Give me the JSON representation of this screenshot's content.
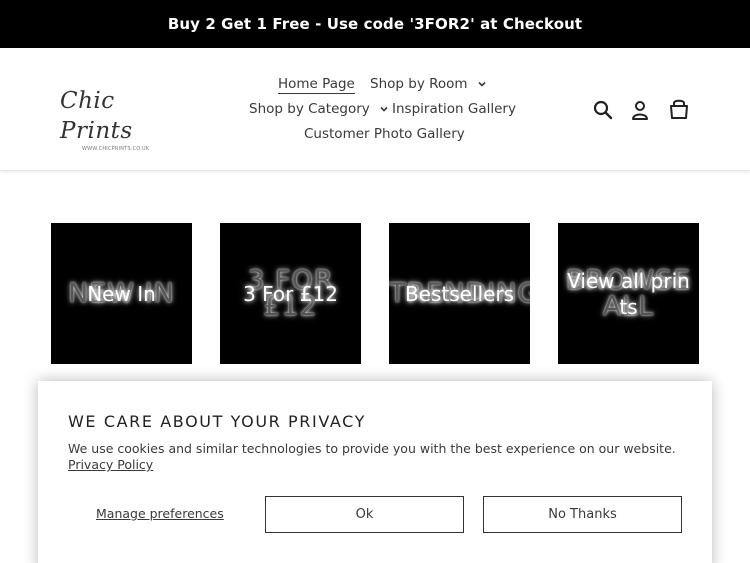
{
  "announcement": "Buy 2 Get 1 Free - Use code '3FOR2' at Checkout",
  "logo": {
    "script": "Chic Prints",
    "sub": "WWW.CHICPRINTS.CO.UK"
  },
  "nav": {
    "home": "Home Page",
    "shop_by_room": "Shop by Room",
    "shop_by_category": "Shop by Category",
    "inspiration": "Inspiration Gallery",
    "customer_photo": "Customer Photo Gallery"
  },
  "header_icons": [
    "search-icon",
    "account-icon",
    "cart-icon"
  ],
  "tiles": [
    {
      "bg": "NEW IN",
      "label": "New In"
    },
    {
      "bg": "3 FOR £12",
      "label": "3 For £12"
    },
    {
      "bg": "TRENDING",
      "label": "Bestsellers"
    },
    {
      "bg": "BROWSE ALL",
      "label": "View all prints"
    }
  ],
  "privacy": {
    "title": "WE CARE ABOUT YOUR PRIVACY",
    "text": "We use cookies and similar technologies to provide you with the best experience on our website.",
    "policy_link": "Privacy Policy",
    "manage": "Manage preferences",
    "ok": "Ok",
    "no_thanks": "No Thanks"
  },
  "colors": {
    "bar": "#000000",
    "text": "#3a3a3a",
    "tile": "#000000"
  }
}
